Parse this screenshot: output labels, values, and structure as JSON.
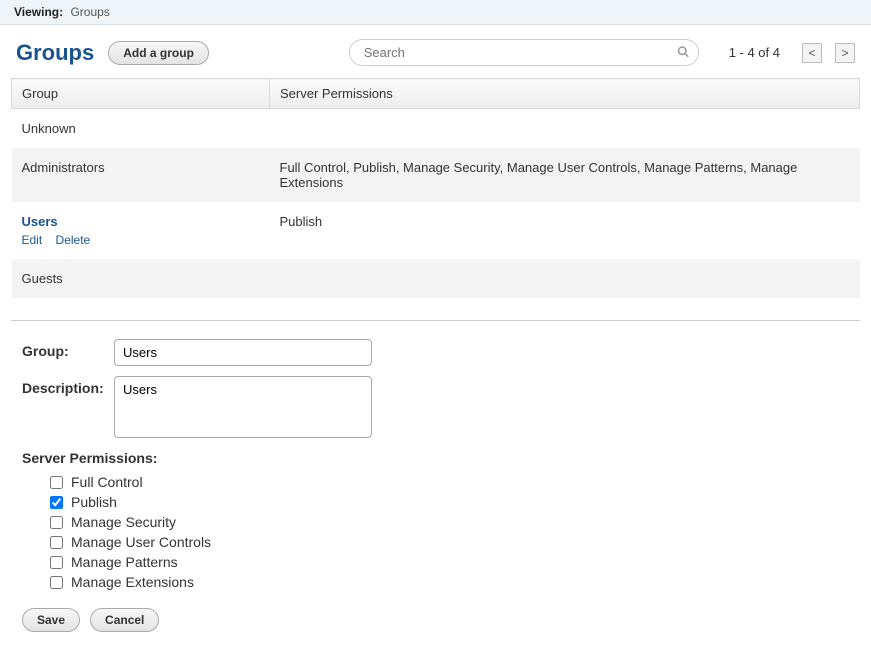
{
  "viewing": {
    "label": "Viewing:",
    "value": "Groups"
  },
  "header": {
    "title": "Groups",
    "add_label": "Add a group",
    "search_placeholder": "Search",
    "pager_text": "1 - 4 of 4",
    "prev": "<",
    "next": ">"
  },
  "table": {
    "col_group": "Group",
    "col_perms": "Server Permissions",
    "rows": [
      {
        "name": "Unknown",
        "perms": "",
        "selected": false
      },
      {
        "name": "Administrators",
        "perms": "Full Control, Publish, Manage Security, Manage User Controls, Manage Patterns, Manage Extensions",
        "selected": false
      },
      {
        "name": "Users",
        "perms": "Publish",
        "selected": true,
        "edit": "Edit",
        "delete": "Delete"
      },
      {
        "name": "Guests",
        "perms": "",
        "selected": false
      }
    ]
  },
  "form": {
    "group_label": "Group:",
    "group_value": "Users",
    "desc_label": "Description:",
    "desc_value": "Users",
    "perm_label": "Server Permissions:",
    "perms": [
      {
        "label": "Full Control",
        "checked": false
      },
      {
        "label": "Publish",
        "checked": true
      },
      {
        "label": "Manage Security",
        "checked": false
      },
      {
        "label": "Manage User Controls",
        "checked": false
      },
      {
        "label": "Manage Patterns",
        "checked": false
      },
      {
        "label": "Manage Extensions",
        "checked": false
      }
    ],
    "save": "Save",
    "cancel": "Cancel"
  }
}
